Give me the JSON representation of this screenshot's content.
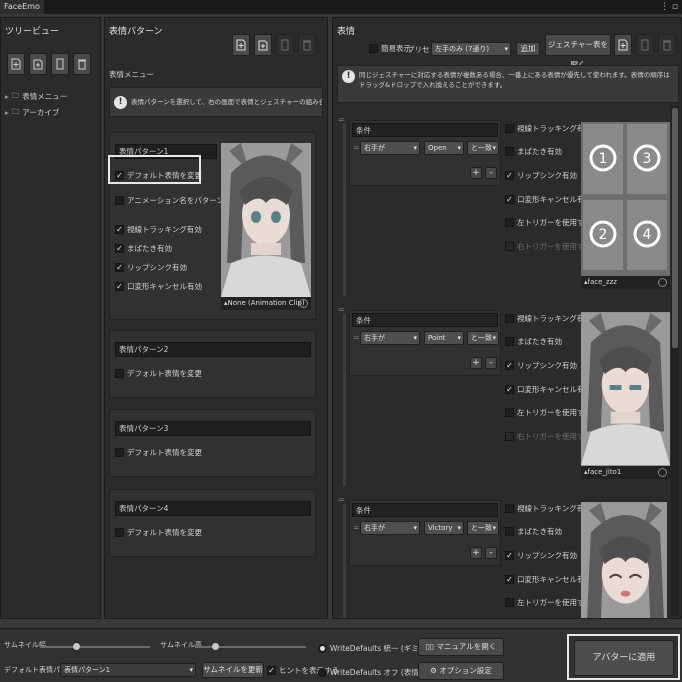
{
  "window": {
    "title": "FaceEmo",
    "menu_icon": "kebab-icon",
    "tab_icon": "window-icon"
  },
  "tree": {
    "title": "ツリービュー",
    "items": [
      {
        "label": "表情メニュー"
      },
      {
        "label": "アーカイブ"
      }
    ]
  },
  "patterns": {
    "title": "表情パターン",
    "subtitle": "表情メニュー",
    "help": "表情パターンを選択して、右の画面で表情とジェスチャーの組み合わせを設定できます。",
    "list": [
      {
        "name": "表情パターン1",
        "default_label": "デフォルト表情を変更",
        "anim_name_label": "アニメーション名をパターン名として使用",
        "options": [
          "視線トラッキング有効",
          "まばたき有効",
          "リップシンク有効",
          "口変形キャンセル有効"
        ],
        "thumb_label": "None (Animation Clip)"
      },
      {
        "name": "表情パターン2",
        "default_label": "デフォルト表情を変更"
      },
      {
        "name": "表情パターン3",
        "default_label": "デフォルト表情を変更"
      },
      {
        "name": "表情パターン4",
        "default_label": "デフォルト表情を変更"
      }
    ]
  },
  "expressions": {
    "title": "表情",
    "simple_label": "簡易表示",
    "preset_label": "プリセット",
    "preset_value": "左手のみ (7通り)",
    "add_label": "追加",
    "gesture_table_label": "ジェスチャー表を開く",
    "help": "同じジェスチャーに対応する表情が複数ある場合、一番上にある表情が優先して使われます。表情の順序はドラッグ&ドロップで入れ換えることができます。",
    "rows": [
      {
        "condition_label": "条件",
        "hand": "右手が",
        "gesture": "Open",
        "relation": "と一致",
        "clip": "face_zzz",
        "options": [
          "視線トラッキング有効",
          "まばたき有効",
          "リップシンク有効",
          "口変形キャンセル有効",
          "左トリガーを使用する",
          "右トリガーを使用する"
        ],
        "checked": [
          false,
          false,
          true,
          true,
          false,
          false
        ]
      },
      {
        "condition_label": "条件",
        "hand": "右手が",
        "gesture": "Point",
        "relation": "と一致",
        "clip": "face_jito1",
        "options": [
          "視線トラッキング有効",
          "まばたき有効",
          "リップシンク有効",
          "口変形キャンセル有効",
          "左トリガーを使用する",
          "右トリガーを使用する"
        ],
        "checked": [
          false,
          false,
          true,
          true,
          false,
          false
        ]
      },
      {
        "condition_label": "条件",
        "hand": "右手が",
        "gesture": "Victory",
        "relation": "と一致",
        "clip": "",
        "options": [
          "視線トラッキング有効",
          "まばたき有効",
          "リップシンク有効",
          "口変形キャンセル有効",
          "左トリガーを使用する"
        ],
        "checked": [
          false,
          false,
          true,
          true,
          false
        ]
      }
    ]
  },
  "bottom": {
    "thumb_width_label": "サムネイル幅",
    "thumb_width_level": 0.35,
    "thumb_height_label": "サムネイル高",
    "thumb_height_level": 0.3,
    "default_pattern_label": "デフォルト表情パターン",
    "default_pattern_value": "表情パターン1",
    "update_thumb_label": "サムネイルを更新",
    "show_hint_label": "ヒントを表示する",
    "wd_on_label": "WriteDefaults 統一 (ギミック優先)",
    "wd_off_label": "WriteDefaults オフ (表情優先)",
    "manual_label": "マニュアルを開く",
    "options_label": "オプション設定",
    "apply_label": "アバターに適用"
  },
  "colors": {
    "accent_highlight": "#e8e8e8",
    "panel": "#2b2b2b",
    "background": "#383838"
  }
}
